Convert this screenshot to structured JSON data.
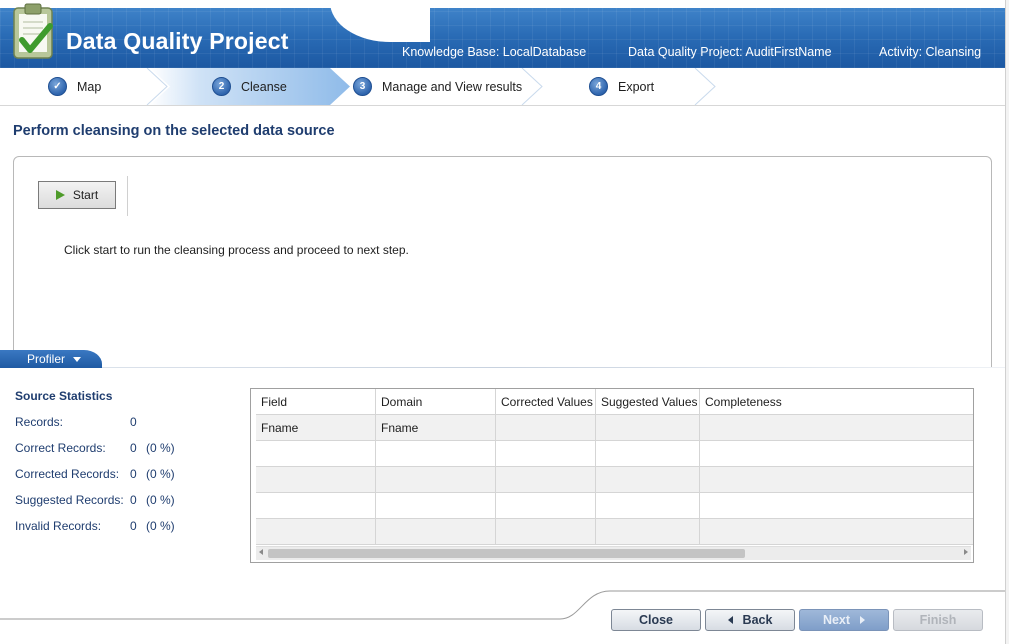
{
  "header": {
    "app_title": "Data Quality Project",
    "knowledge_base": "Knowledge Base: LocalDatabase",
    "project": "Data Quality Project: AuditFirstName",
    "activity": "Activity: Cleansing",
    "icon": "clipboard-check-icon"
  },
  "steps": [
    {
      "number": "✓",
      "label": "Map",
      "state": "done"
    },
    {
      "number": "2",
      "label": "Cleanse",
      "state": "active"
    },
    {
      "number": "3",
      "label": "Manage and View results",
      "state": "pending"
    },
    {
      "number": "4",
      "label": "Export",
      "state": "pending"
    }
  ],
  "main": {
    "heading": "Perform cleansing on the selected data source",
    "start_label": "Start",
    "hint": "Click start to run the cleansing process and proceed to next step."
  },
  "profiler": {
    "tab_label": "Profiler",
    "stats_title": "Source Statistics",
    "stats": [
      {
        "label": "Records:",
        "value": "0",
        "pct": ""
      },
      {
        "label": "Correct Records:",
        "value": "0",
        "pct": "(0 %)"
      },
      {
        "label": "Corrected Records:",
        "value": "0",
        "pct": "(0 %)"
      },
      {
        "label": "Suggested Records:",
        "value": "0",
        "pct": "(0 %)"
      },
      {
        "label": "Invalid Records:",
        "value": "0",
        "pct": "(0 %)"
      }
    ],
    "columns": [
      "Field",
      "Domain",
      "Corrected Values",
      "Suggested Values",
      "Completeness"
    ],
    "rows": [
      [
        "Fname",
        "Fname",
        "",
        "",
        ""
      ]
    ]
  },
  "footer": {
    "close_label": "Close",
    "back_label": "Back",
    "next_label": "Next",
    "finish_label": "Finish"
  },
  "colors": {
    "header_blue": "#1c58a2",
    "heading_blue": "#1f3d6f",
    "step_active": "#aed0f0"
  }
}
